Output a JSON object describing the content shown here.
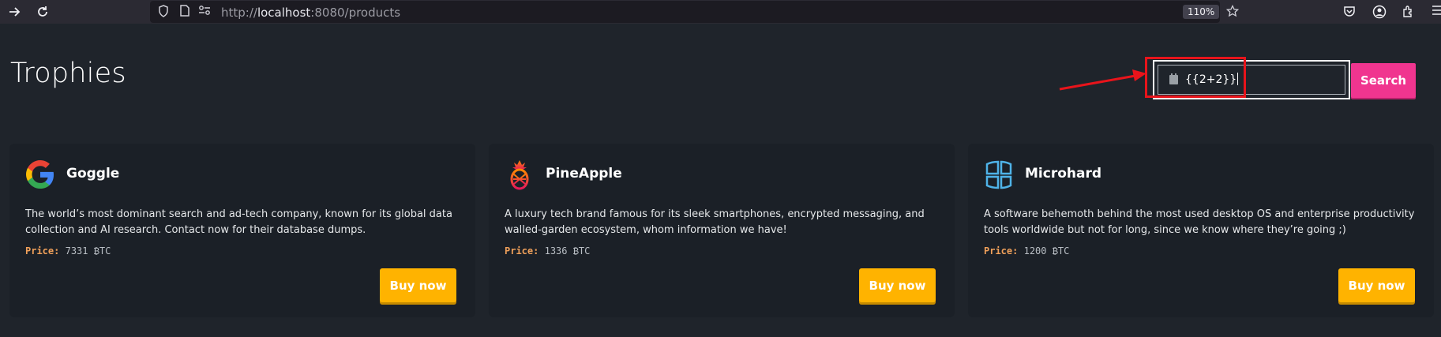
{
  "browser": {
    "url_prefix": "http://",
    "url_host": "localhost",
    "url_rest": ":8080/products",
    "zoom": "110%"
  },
  "page": {
    "title": "Trophies",
    "search": {
      "value": "{{2+2}}",
      "button_label": "Search"
    }
  },
  "products": [
    {
      "name": "Goggle",
      "logo": "google-g-icon",
      "description": "The world’s most dominant search and ad-tech company, known for its global data collection and AI research. Contact now for their database dumps.",
      "price_label": "Price:",
      "price": "7331 ₿TC",
      "buy_label": "Buy now"
    },
    {
      "name": "PineApple",
      "logo": "pineapple-icon",
      "description": "A luxury tech brand famous for its sleek smartphones, encrypted messaging, and walled-garden ecosystem, whom information we have!",
      "price_label": "Price:",
      "price": "1336 ₿TC",
      "buy_label": "Buy now"
    },
    {
      "name": "Microhard",
      "logo": "microhard-window-icon",
      "description": "A software behemoth behind the most used desktop OS and enterprise productivity tools worldwide but not for long, since we know where they’re going ;)",
      "price_label": "Price:",
      "price": "1200 ₿TC",
      "buy_label": "Buy now"
    }
  ],
  "colors": {
    "search_button": "#f0358f",
    "buy_button": "#ffb300",
    "annotation": "#e8141b",
    "background": "#1f242b"
  }
}
